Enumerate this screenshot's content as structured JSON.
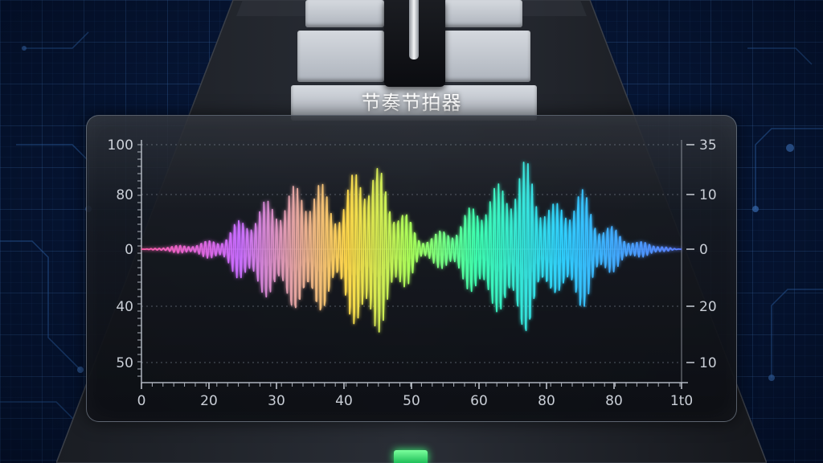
{
  "app": {
    "title": "节奏节拍器"
  },
  "colors": {
    "background": "#07183a",
    "grid": "#3f7ed0",
    "screen_border": "#9aa3af",
    "wave_gradient": [
      "#ff5ca8",
      "#c86cff",
      "#ffd84a",
      "#a8ff5a",
      "#3dffb0",
      "#2fd0ff",
      "#5a7bff"
    ],
    "led": "#3dff7a"
  },
  "icons": {
    "pendulum": "metronome-pendulum-icon",
    "indicator": "green-led-icon"
  },
  "chart_data": {
    "type": "line",
    "xlabel": "",
    "ylabel": "",
    "x_ticks": [
      "0",
      "20",
      "30",
      "40",
      "50",
      "60",
      "80",
      "80",
      "1t0"
    ],
    "y_left_ticks": [
      "100",
      "80",
      "0",
      "40",
      "50"
    ],
    "y_right_ticks": [
      "35",
      "10",
      "0",
      "20",
      "10"
    ],
    "x_range": [
      0,
      100
    ],
    "zero_line": true,
    "grid": true,
    "series": [
      {
        "style": "oscillating waveform with rainbow gradient",
        "envelope": [
          {
            "x": 0,
            "amp": 0
          },
          {
            "x": 8,
            "amp": 4
          },
          {
            "x": 14,
            "amp": 10
          },
          {
            "x": 20,
            "amp": 38
          },
          {
            "x": 25,
            "amp": 55
          },
          {
            "x": 32,
            "amp": 72
          },
          {
            "x": 36,
            "amp": 48
          },
          {
            "x": 42,
            "amp": 100
          },
          {
            "x": 47,
            "amp": 55
          },
          {
            "x": 52,
            "amp": 12
          },
          {
            "x": 57,
            "amp": 22
          },
          {
            "x": 64,
            "amp": 60
          },
          {
            "x": 71,
            "amp": 88
          },
          {
            "x": 76,
            "amp": 45
          },
          {
            "x": 81,
            "amp": 62
          },
          {
            "x": 86,
            "amp": 25
          },
          {
            "x": 92,
            "amp": 8
          },
          {
            "x": 100,
            "amp": 0
          }
        ]
      }
    ]
  }
}
